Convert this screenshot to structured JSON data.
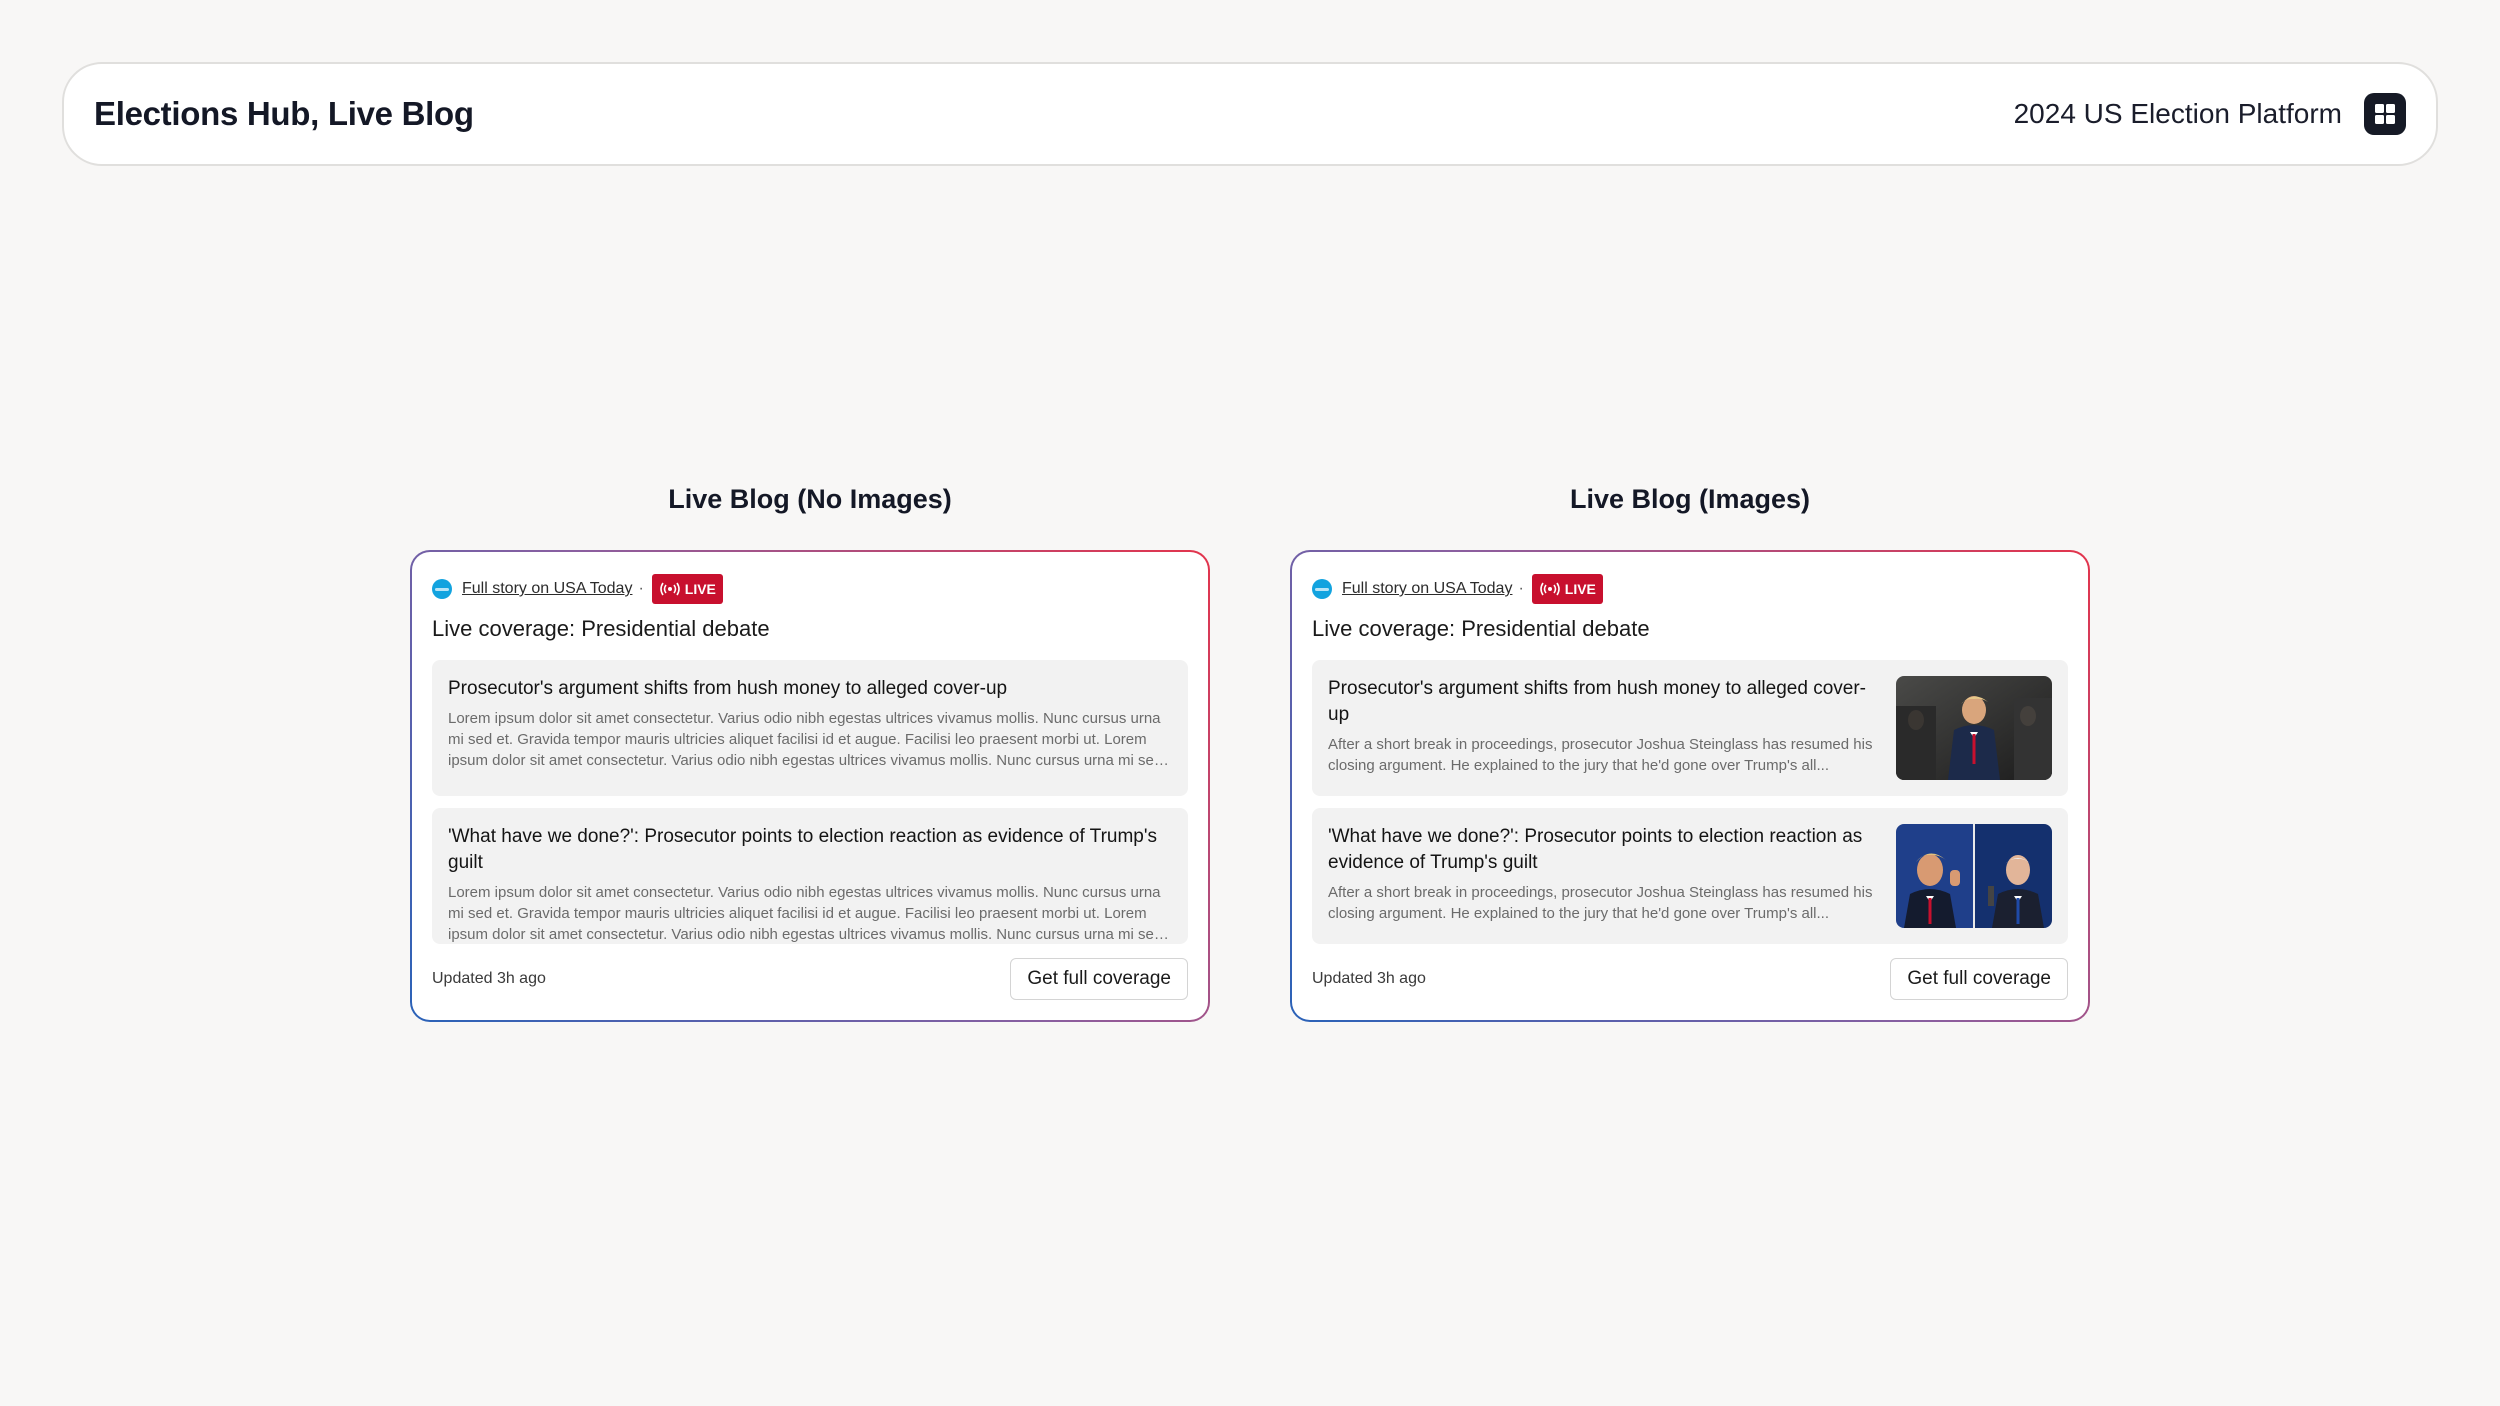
{
  "header": {
    "title": "Elections Hub, Live Blog",
    "platform": "2024 US Election Platform",
    "app_icon": "grid-icon"
  },
  "colors": {
    "live_red": "#c8102e",
    "border_blue": "#2a62b8",
    "border_red": "#e3344c",
    "source_blue": "#12a3df"
  },
  "sections": [
    {
      "title": "Live Blog (No Images)",
      "card": {
        "source_link": "Full story on USA Today",
        "separator": "·",
        "live_label": "LIVE",
        "headline": "Live coverage: Presidential debate",
        "items": [
          {
            "title": "Prosecutor's argument shifts from hush money to alleged cover-up",
            "body": "Lorem ipsum dolor sit amet consectetur. Varius odio nibh egestas ultrices vivamus mollis. Nunc cursus urna mi sed et. Gravida tempor mauris ultricies aliquet facilisi id et augue. Facilisi leo praesent morbi ut. Lorem ipsum dolor sit amet consectetur. Varius odio nibh egestas ultrices vivamus mollis. Nunc cursus urna mi sed et."
          },
          {
            "title": "'What have we done?': Prosecutor points to election reaction as evidence of Trump's guilt",
            "body": "Lorem ipsum dolor sit amet consectetur. Varius odio nibh egestas ultrices vivamus mollis. Nunc cursus urna mi sed et. Gravida tempor mauris ultricies aliquet facilisi id et augue. Facilisi leo praesent morbi ut. Lorem ipsum dolor sit amet consectetur. Varius odio nibh egestas ultrices vivamus mollis. Nunc cursus urna mi sed et."
          }
        ],
        "updated": "Updated 3h ago",
        "cta": "Get full coverage"
      }
    },
    {
      "title": "Live Blog (Images)",
      "card": {
        "source_link": "Full story on USA Today",
        "separator": "·",
        "live_label": "LIVE",
        "headline": "Live coverage: Presidential debate",
        "items": [
          {
            "title": "Prosecutor's argument shifts from hush money to alleged cover-up",
            "body": "After a short break in proceedings, prosecutor Joshua Steinglass has resumed his closing argument. He explained to the jury that he'd gone over Trump's all..."
          },
          {
            "title": "'What have we done?': Prosecutor points to election reaction as evidence of Trump's guilt",
            "body": "After a short break in proceedings, prosecutor Joshua Steinglass has resumed his closing argument. He explained to the jury that he'd gone over Trump's all..."
          }
        ],
        "updated": "Updated 3h ago",
        "cta": "Get full coverage"
      }
    }
  ]
}
